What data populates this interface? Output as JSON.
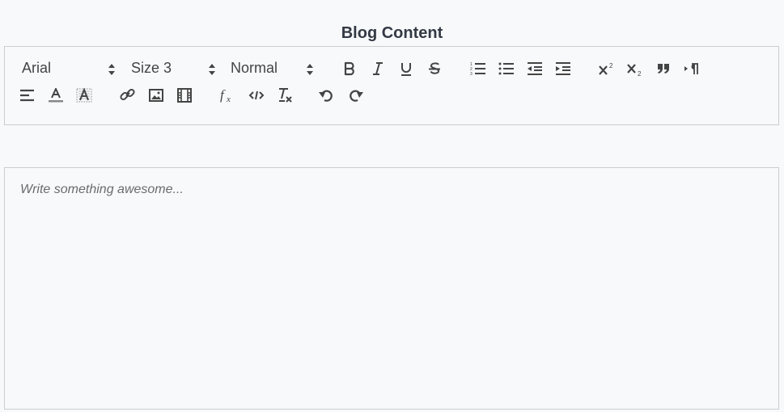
{
  "header": {
    "title": "Blog Content"
  },
  "toolbar": {
    "font_picker": {
      "value": "Arial"
    },
    "size_picker": {
      "value": "Size 3"
    },
    "header_picker": {
      "value": "Normal"
    },
    "icons": {
      "bold": "bold-icon",
      "italic": "italic-icon",
      "underline": "underline-icon",
      "strike": "strikethrough-icon",
      "ordered_list": "ordered-list-icon",
      "bullet_list": "bullet-list-icon",
      "outdent": "outdent-icon",
      "indent": "indent-icon",
      "superscript": "superscript-icon",
      "subscript": "subscript-icon",
      "blockquote": "blockquote-icon",
      "direction": "text-direction-icon",
      "align": "align-left-icon",
      "color": "text-color-icon",
      "background": "background-color-icon",
      "link": "link-icon",
      "image": "image-icon",
      "video": "video-icon",
      "formula": "formula-icon",
      "code": "code-icon",
      "clean": "clear-format-icon",
      "undo": "undo-icon",
      "redo": "redo-icon"
    }
  },
  "editor": {
    "placeholder": "Write something awesome..."
  },
  "colors": {
    "icon": "#444444",
    "border": "#cccccc",
    "background": "#f8f9fb",
    "title": "#333a44"
  }
}
